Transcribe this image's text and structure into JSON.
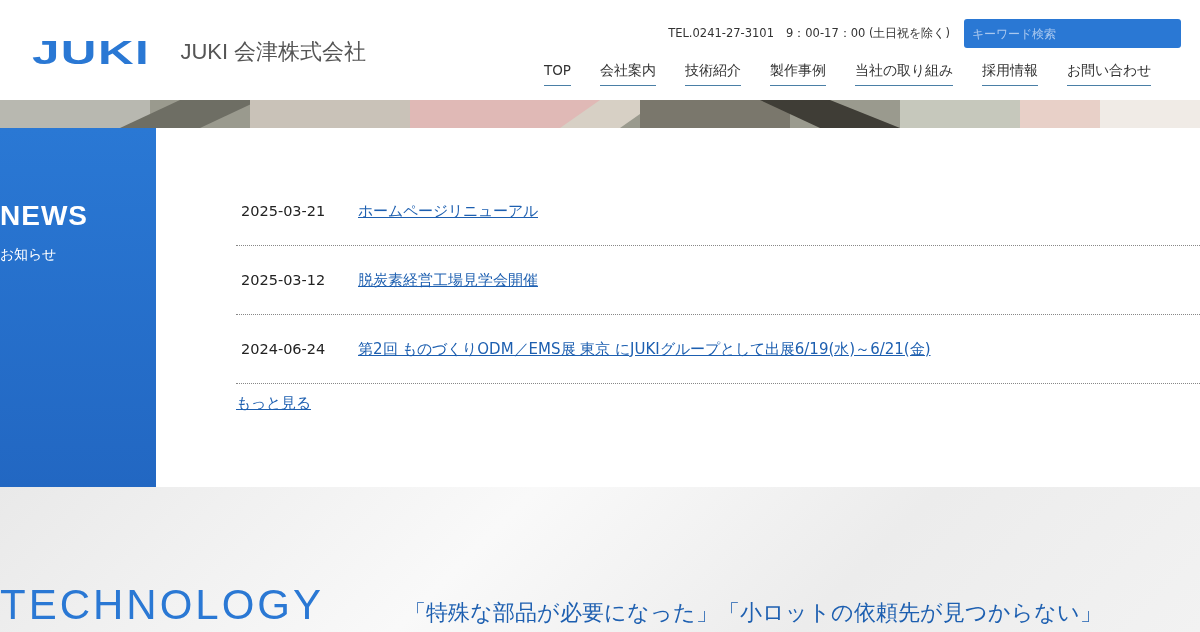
{
  "header": {
    "logo_mark": "JUKI",
    "company_name": "JUKI 会津株式会社",
    "contact": "TEL.0241-27-3101　9：00-17：00 (土日祝を除く)",
    "search": {
      "placeholder": "キーワード検索"
    },
    "nav": [
      "TOP",
      "会社案内",
      "技術紹介",
      "製作事例",
      "当社の取り組み",
      "採用情報",
      "お問い合わせ"
    ]
  },
  "news": {
    "title": "NEWS",
    "subtitle": "お知らせ",
    "items": [
      {
        "date": "2025-03-21",
        "title": "ホームページリニューアル"
      },
      {
        "date": "2025-03-12",
        "title": "脱炭素経営工場見学会開催"
      },
      {
        "date": "2024-06-24",
        "title": "第2回 ものづくりODM／EMS展 東京 にJUKIグループとして出展6/19(水)～6/21(金)"
      }
    ],
    "more_link": "もっと見る"
  },
  "technology": {
    "title": "TECHNOLOGY",
    "lead": "「特殊な部品が必要になった」「小ロットの依頼先が見つからない」"
  }
}
